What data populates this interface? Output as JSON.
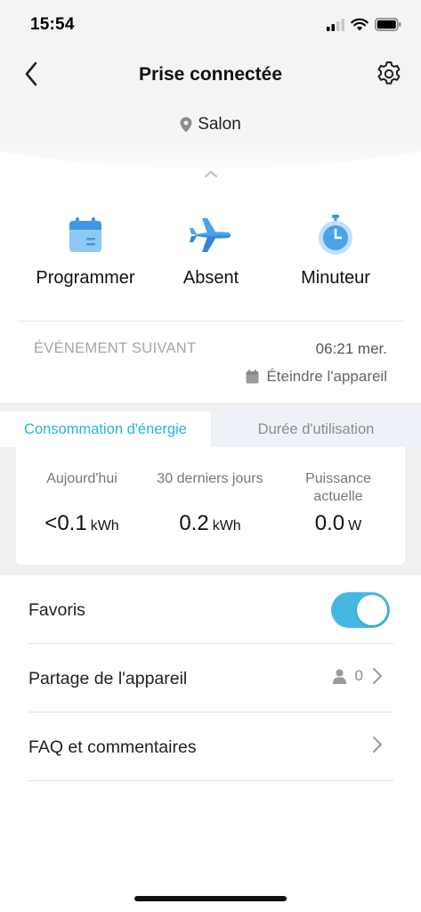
{
  "status_bar": {
    "time": "15:54"
  },
  "header": {
    "title": "Prise connectée",
    "location": "Salon"
  },
  "actions": [
    {
      "label": "Programmer",
      "icon": "calendar-icon"
    },
    {
      "label": "Absent",
      "icon": "airplane-icon"
    },
    {
      "label": "Minuteur",
      "icon": "stopwatch-icon"
    }
  ],
  "next_event": {
    "title": "ÉVÉNEMENT SUIVANT",
    "time": "06:21 mer.",
    "action": "Éteindre l'appareil"
  },
  "energy": {
    "tabs": [
      {
        "label": "Consommation d'énergie",
        "active": true
      },
      {
        "label": "Durée d'utilisation",
        "active": false
      }
    ],
    "stats": [
      {
        "label": "Aujourd'hui",
        "value": "<0.1",
        "unit": "kWh"
      },
      {
        "label": "30 derniers jours",
        "value": "0.2",
        "unit": "kWh"
      },
      {
        "label": "Puissance actuelle",
        "value": "0.0",
        "unit": "W"
      }
    ]
  },
  "settings": {
    "favorites_label": "Favoris",
    "favorites_on": true,
    "sharing_label": "Partage de l'appareil",
    "sharing_count": "0",
    "faq_label": "FAQ et commentaires"
  },
  "colors": {
    "accent": "#27b3d7",
    "toggle": "#44b8e1",
    "icon_blue": "#4aa3e8"
  }
}
